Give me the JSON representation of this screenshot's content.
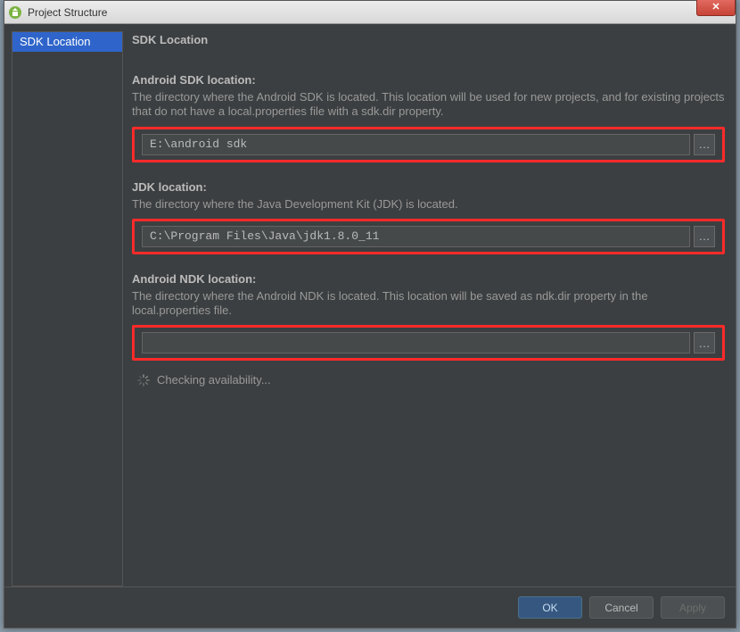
{
  "window": {
    "title": "Project Structure",
    "close_symbol": "✕"
  },
  "sidebar": {
    "items": [
      {
        "label": "SDK Location",
        "selected": true
      }
    ]
  },
  "page": {
    "title": "SDK Location"
  },
  "sections": {
    "sdk": {
      "label": "Android SDK location:",
      "desc": "The directory where the Android SDK is located. This location will be used for new projects, and for existing projects that do not have a local.properties file with a sdk.dir property.",
      "value": "E:\\android sdk",
      "browse": "…"
    },
    "jdk": {
      "label": "JDK location:",
      "desc": "The directory where the Java Development Kit (JDK) is located.",
      "value": "C:\\Program Files\\Java\\jdk1.8.0_11",
      "browse": "…"
    },
    "ndk": {
      "label": "Android NDK location:",
      "desc": "The directory where the Android NDK is located. This location will be saved as ndk.dir property in the local.properties file.",
      "value": "",
      "browse": "…"
    }
  },
  "status": {
    "text": "Checking availability..."
  },
  "footer": {
    "ok": "OK",
    "cancel": "Cancel",
    "apply": "Apply"
  }
}
